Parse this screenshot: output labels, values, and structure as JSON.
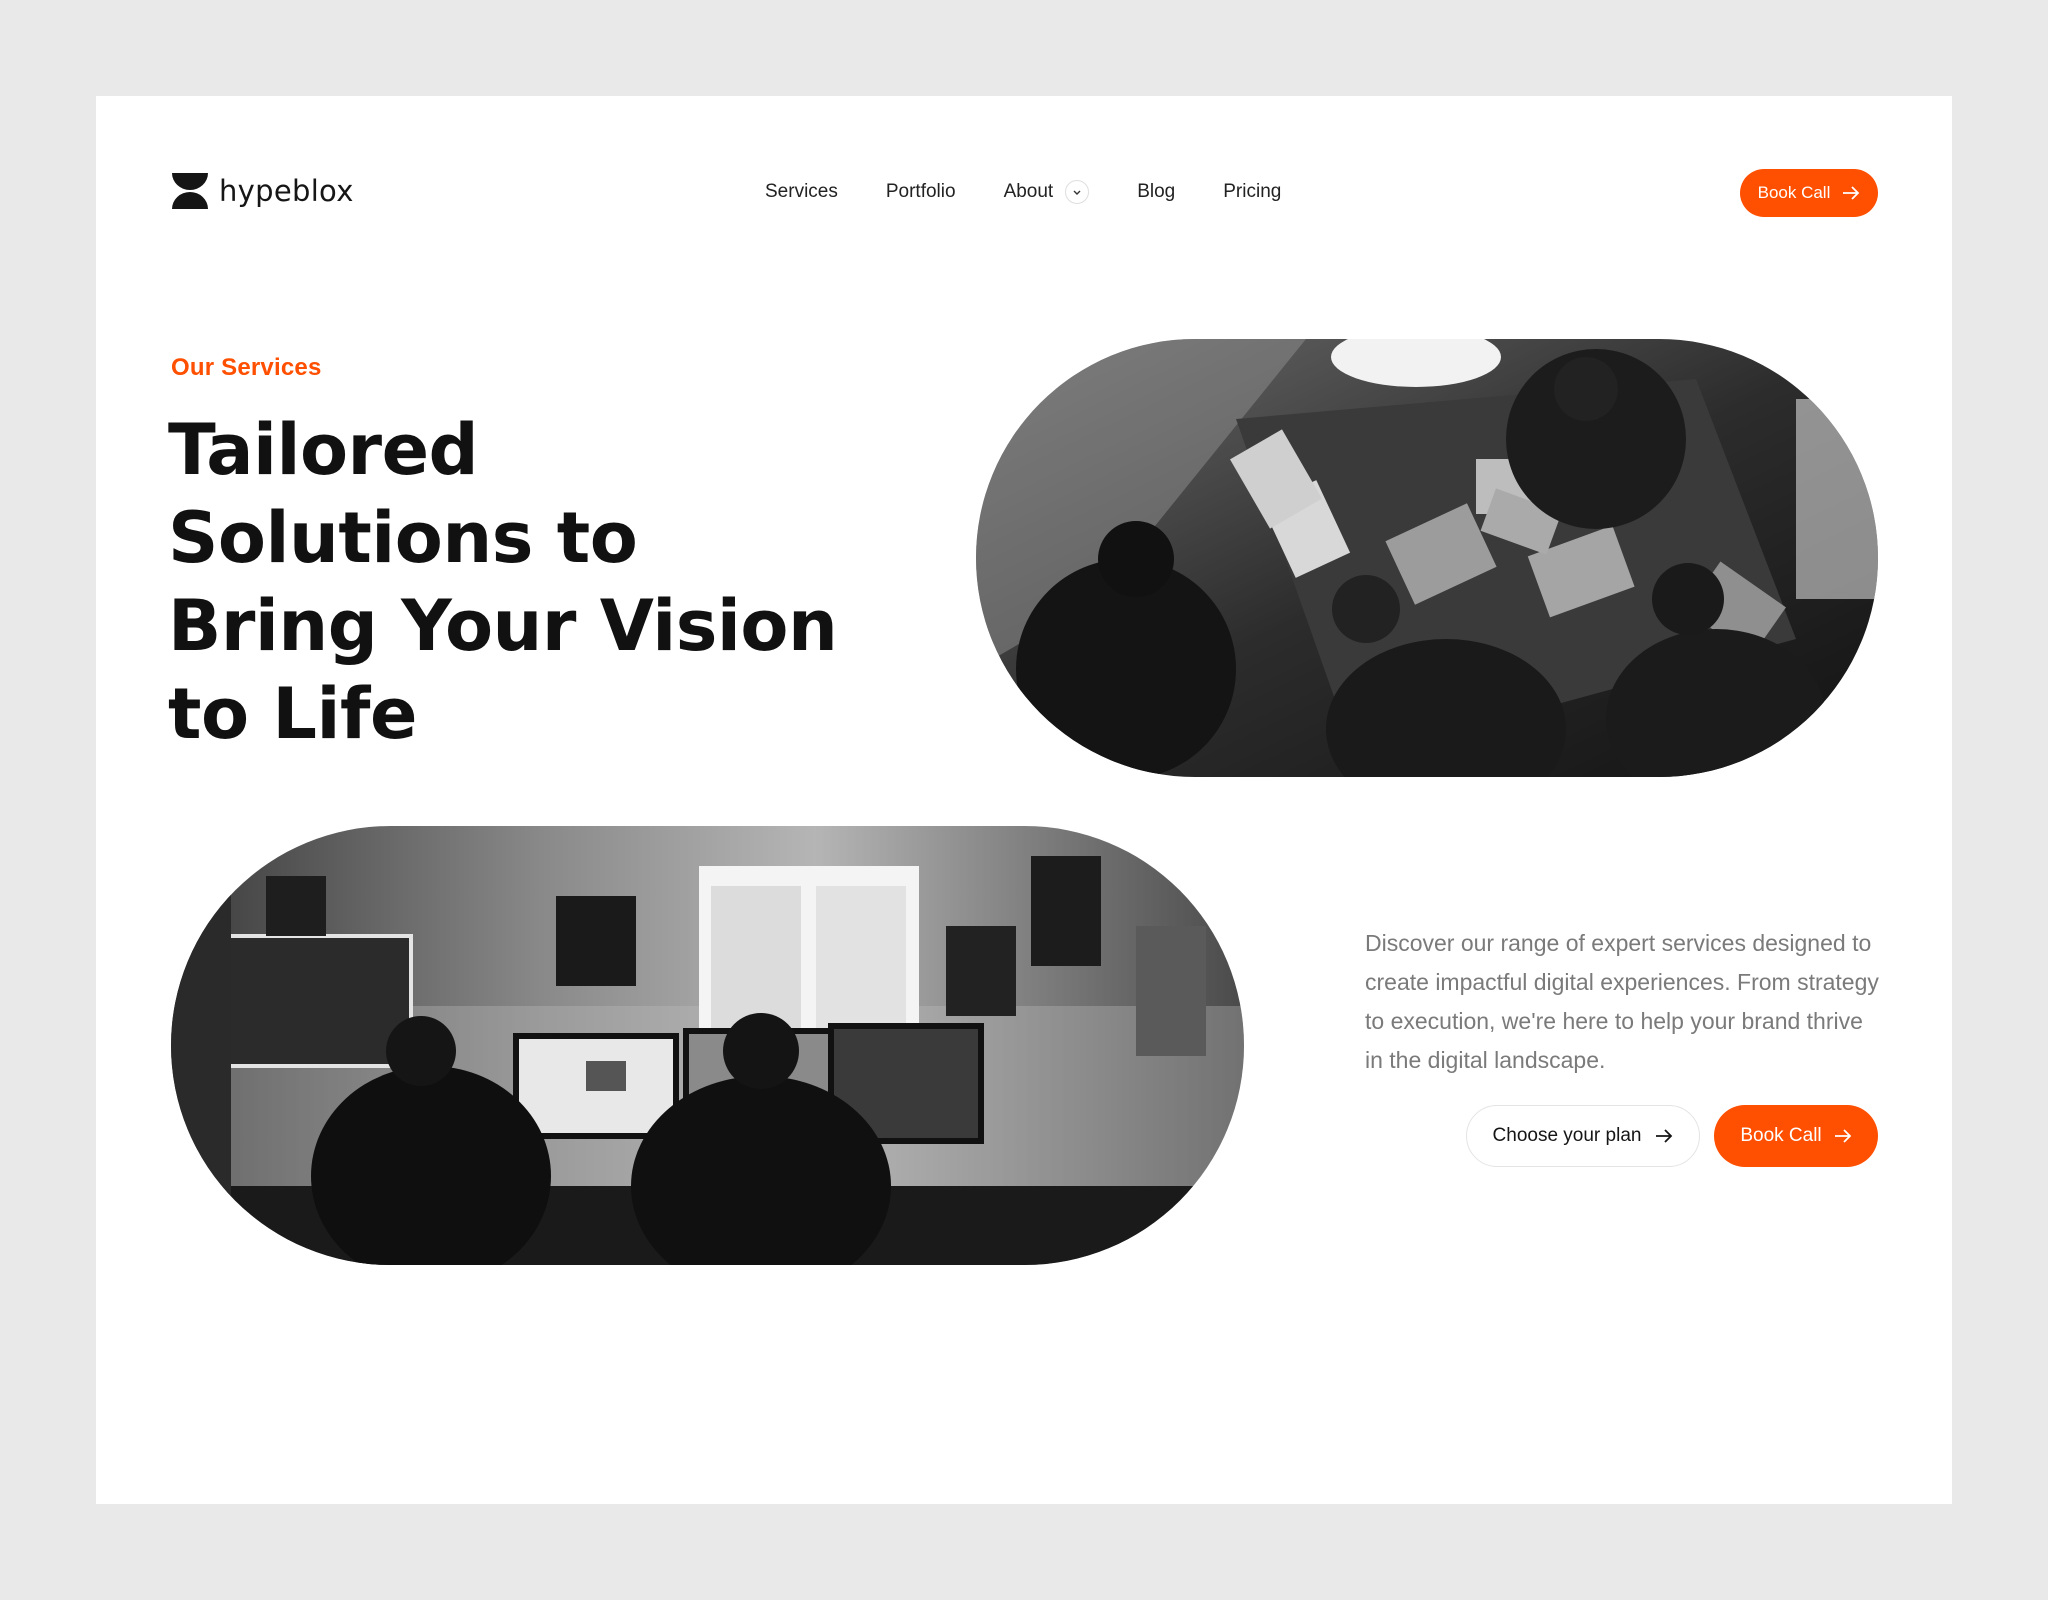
{
  "brand": {
    "name": "hypeblox",
    "logo_icon": "hourglass-logo-icon",
    "accent_color": "#ff4f00"
  },
  "nav": {
    "items": [
      {
        "label": "Services"
      },
      {
        "label": "Portfolio"
      },
      {
        "label": "About",
        "has_dropdown": true
      },
      {
        "label": "Blog"
      },
      {
        "label": "Pricing"
      }
    ]
  },
  "header": {
    "cta_label": "Book Call",
    "cta_icon": "arrow-right-icon"
  },
  "hero": {
    "eyebrow": "Our Services",
    "headline_lines": [
      "Tailored",
      "Solutions to",
      "Bring Your Vision",
      "to Life"
    ],
    "description": "Discover our range of expert services designed to create impactful digital experiences. From strategy to execution, we're here to help your brand thrive in the digital landscape.",
    "secondary_cta": "Choose your plan",
    "primary_cta": "Book Call",
    "images": [
      {
        "alt": "Team working on laptops around a table, black and white photo"
      },
      {
        "alt": "Two people working at desks with multiple monitors, black and white photo"
      }
    ]
  }
}
